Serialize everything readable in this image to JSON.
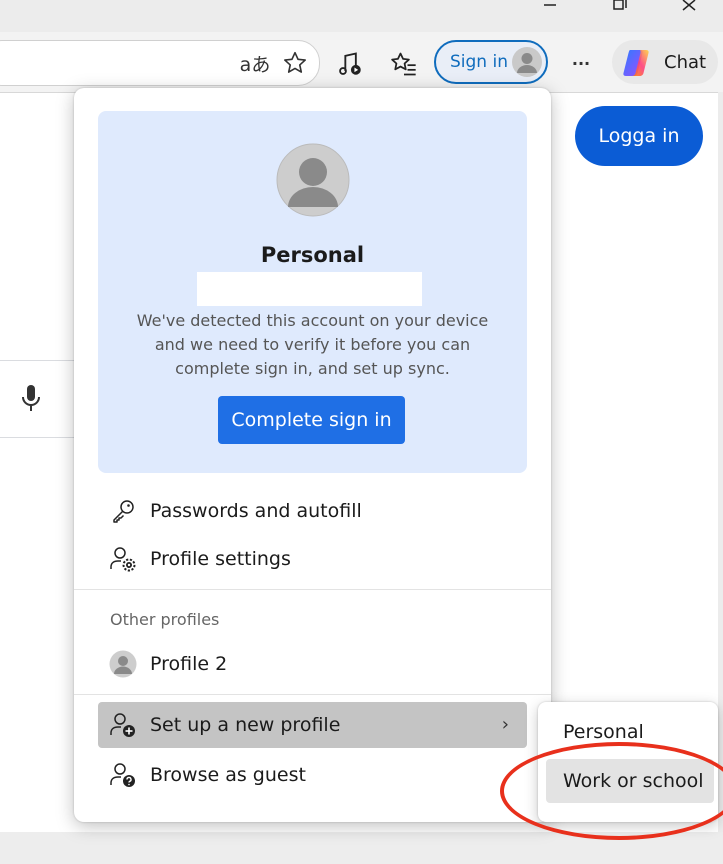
{
  "toolbar": {
    "signin_label": "Sign in",
    "chat_label": "Chat",
    "read_aloud_glyph": "aあ",
    "more_glyph": "···"
  },
  "page": {
    "login_button": "Logga in"
  },
  "profile_menu": {
    "profile_name": "Personal",
    "message": "We've detected this account on your device and we need to verify it before you can complete sign in, and set up sync.",
    "complete_button": "Complete sign in",
    "items": [
      {
        "label": "Passwords and autofill",
        "icon": "key-icon"
      },
      {
        "label": "Profile settings",
        "icon": "person-gear-icon"
      }
    ],
    "other_profiles_label": "Other profiles",
    "other_profile": "Profile 2",
    "setup_label": "Set up a new profile",
    "chevron": "›",
    "guest_label": "Browse as guest"
  },
  "submenu": {
    "items": [
      "Personal",
      "Work or school"
    ]
  },
  "colors": {
    "accent": "#0f6cbd",
    "complete_button": "#1f6fe5",
    "annotation": "#e8301c",
    "card": "#dfeafd"
  }
}
